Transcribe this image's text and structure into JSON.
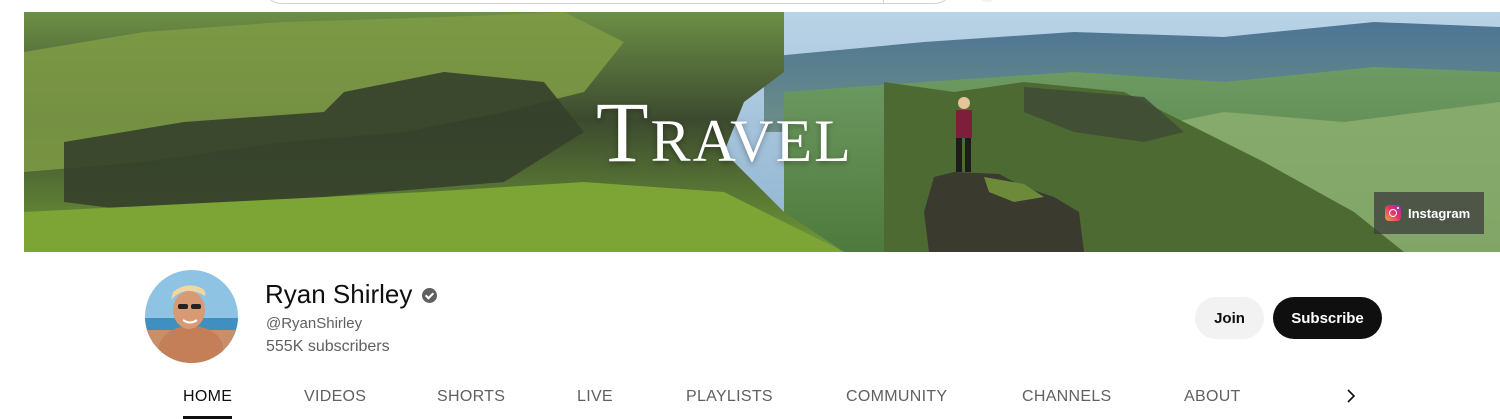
{
  "banner": {
    "title_first": "T",
    "title_rest": "RAVEL",
    "link_label": "Instagram",
    "link_icon": "instagram-icon"
  },
  "channel": {
    "name": "Ryan Shirley",
    "verified_icon": "verified-check-icon",
    "handle": "@RyanShirley",
    "subscribers": "555K subscribers"
  },
  "actions": {
    "join_label": "Join",
    "subscribe_label": "Subscribe"
  },
  "tabs": [
    {
      "label": "HOME",
      "active": true
    },
    {
      "label": "VIDEOS",
      "active": false
    },
    {
      "label": "SHORTS",
      "active": false
    },
    {
      "label": "LIVE",
      "active": false
    },
    {
      "label": "PLAYLISTS",
      "active": false
    },
    {
      "label": "COMMUNITY",
      "active": false
    },
    {
      "label": "CHANNELS",
      "active": false
    },
    {
      "label": "ABOUT",
      "active": false
    }
  ],
  "colors": {
    "subscribe_bg": "#0f0f0f",
    "join_bg": "#f2f2f2",
    "secondary_text": "#606060"
  }
}
